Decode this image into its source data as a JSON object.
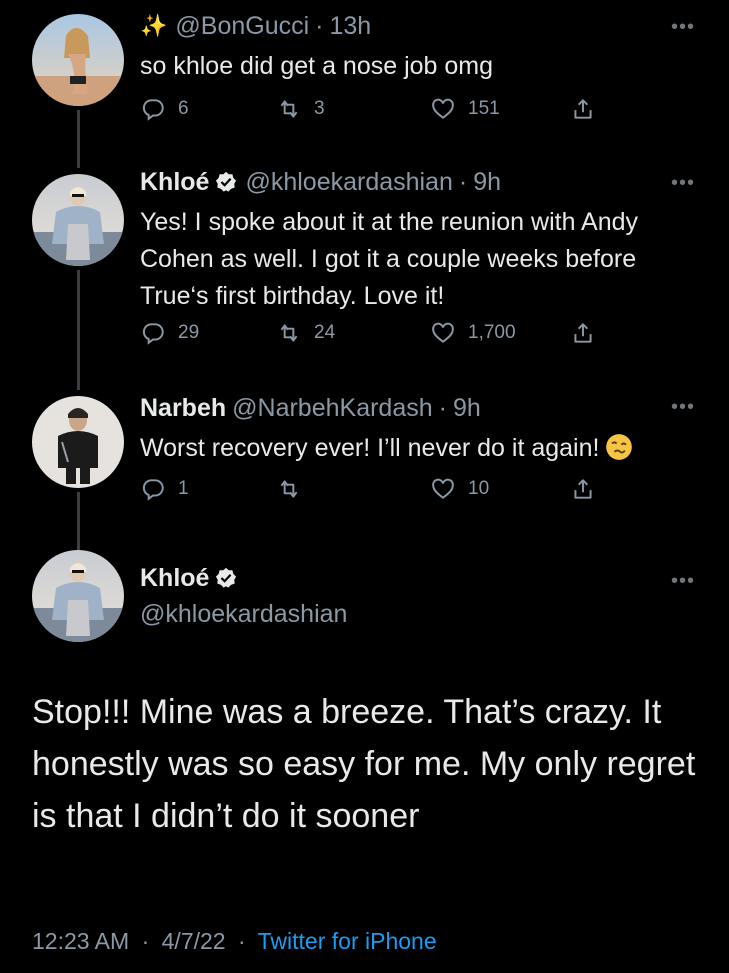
{
  "tweets": [
    {
      "author_name": "",
      "handle": "@BonGucci",
      "time": "13h",
      "text": "so khloe did get a nose job omg",
      "replies": "6",
      "retweets": "3",
      "likes": "151",
      "sparkle_icon": "✨"
    },
    {
      "author_name": "Khloé",
      "handle": "@khloekardashian",
      "time": "9h",
      "text": "Yes! I spoke about it at the reunion with Andy Cohen as well. I got it a couple weeks before True‘s first birthday. Love it!",
      "replies": "29",
      "retweets": "24",
      "likes": "1,700"
    },
    {
      "author_name": "Narbeh",
      "handle": "@NarbehKardash",
      "time": "9h",
      "text": "Worst recovery ever! I’ll never do it again!",
      "replies": "1",
      "retweets": "",
      "likes": "10"
    }
  ],
  "main_tweet": {
    "author_name": "Khloé",
    "handle": "@khloekardashian",
    "text": "Stop!!! Mine was a breeze. That’s crazy. It honestly was so easy for me. My only regret is that I didn’t do it sooner",
    "time": "12:23 AM",
    "date": "4/7/22",
    "source": "Twitter for iPhone"
  },
  "separator": "·",
  "more_label": "•••",
  "colors": {
    "background": "#000000",
    "text": "#e7e9ea",
    "muted": "#8b98a5",
    "link": "#1d9bf0",
    "thread_line": "#3a3f44"
  },
  "icons": [
    "sparkle-icon",
    "verified-badge-icon",
    "reply-icon",
    "retweet-icon",
    "like-icon",
    "share-icon",
    "more-icon",
    "woozy-face-emoji"
  ]
}
